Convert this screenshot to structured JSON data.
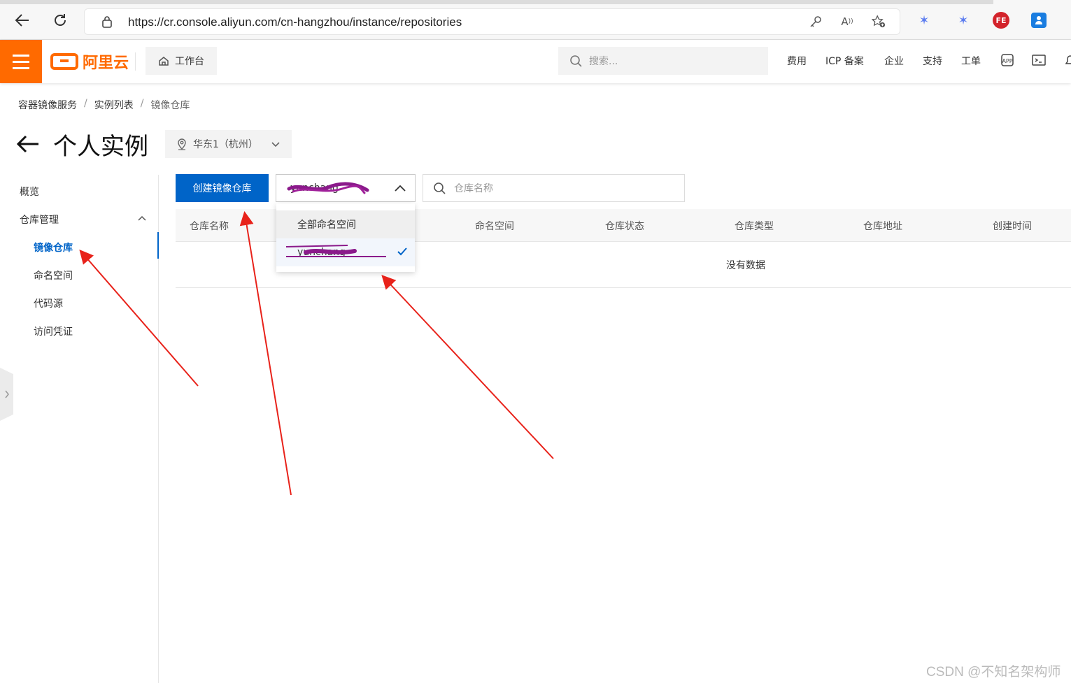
{
  "browser": {
    "url": "https://cr.console.aliyun.com/cn-hangzhou/instance/repositories"
  },
  "header": {
    "logo_text": "阿里云",
    "workbench_label": "工作台",
    "search_placeholder": "搜索...",
    "links": [
      "费用",
      "ICP 备案",
      "企业",
      "支持",
      "工单"
    ]
  },
  "breadcrumb": [
    "容器镜像服务",
    "实例列表",
    "镜像仓库"
  ],
  "page": {
    "title": "个人实例",
    "region": "华东1（杭州）"
  },
  "sidenav": {
    "overview": "概览",
    "repo_management": "仓库管理",
    "items": [
      "镜像仓库",
      "命名空间",
      "代码源",
      "访问凭证"
    ]
  },
  "toolbar": {
    "create_button": "创建镜像仓库",
    "namespace_value": "yunchang",
    "search_placeholder": "仓库名称"
  },
  "dropdown": {
    "options": [
      "全部命名空间",
      "yunchang"
    ]
  },
  "table": {
    "columns": [
      "仓库名称",
      "命名空间",
      "仓库状态",
      "仓库类型",
      "仓库地址",
      "创建时间"
    ],
    "empty_text": "没有数据"
  },
  "watermark": "CSDN @不知名架构师",
  "colors": {
    "brand_orange": "#ff6a00",
    "primary_blue": "#0064c8",
    "annotation_red": "#e8221a",
    "scribble_purple": "#8b1a8b"
  }
}
